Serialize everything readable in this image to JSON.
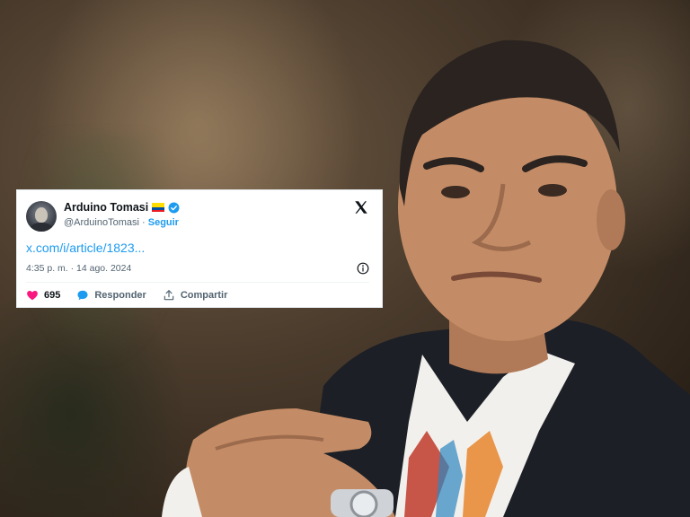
{
  "tweet": {
    "display_name": "Arduino Tomasi",
    "handle": "@ArduinoTomasi",
    "separator": "·",
    "follow_label": "Seguir",
    "link_text": "x.com/i/article/1823...",
    "timestamp": "4:35 p. m. · 14 ago. 2024",
    "likes_count": "695",
    "reply_label": "Responder",
    "share_label": "Compartir"
  },
  "icons": {
    "flag": "ecuador-flag-icon",
    "verified": "verified-badge-icon",
    "logo": "x-logo-icon",
    "info": "info-icon",
    "like": "heart-icon",
    "reply": "speech-bubble-icon",
    "share": "share-icon"
  },
  "colors": {
    "accent": "#1d9bf0",
    "like": "#f91880",
    "text": "#0f1419",
    "muted": "#536471"
  }
}
